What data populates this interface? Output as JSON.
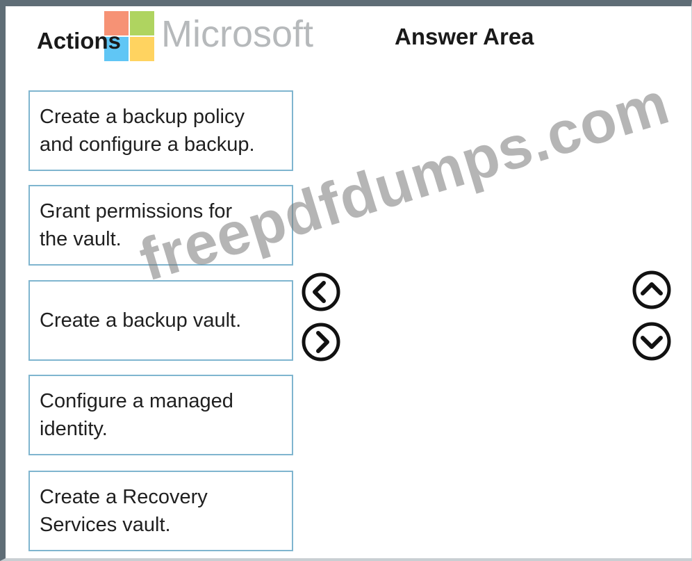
{
  "watermark_logo": {
    "wordmark": "Microsoft",
    "colors": {
      "red": "#f25022",
      "green": "#7fba00",
      "blue": "#00a4ef",
      "yellow": "#ffb900"
    }
  },
  "watermark_text": "freepdfdumps.com",
  "actions": {
    "heading": "Actions",
    "items": [
      {
        "lines": [
          "Create a backup policy",
          "and configure a backup."
        ]
      },
      {
        "lines": [
          "Grant permissions for",
          "the vault."
        ]
      },
      {
        "lines": [
          "Create a backup vault."
        ]
      },
      {
        "lines": [
          "Configure a managed",
          "identity."
        ]
      },
      {
        "lines": [
          "Create a Recovery",
          "Services vault."
        ]
      }
    ]
  },
  "answer_area": {
    "heading": "Answer Area",
    "items": []
  },
  "controls": {
    "move_left": "chevron-left-icon",
    "move_right": "chevron-right-icon",
    "move_up": "chevron-up-icon",
    "move_down": "chevron-down-icon"
  },
  "colors": {
    "card_border": "#7fb5cf",
    "frame": "#5f6d76"
  }
}
